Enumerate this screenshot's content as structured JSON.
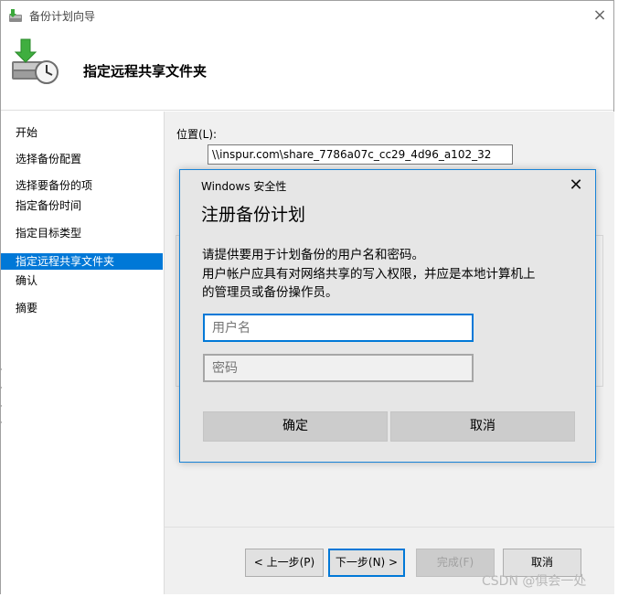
{
  "window": {
    "title": "备份计划向导",
    "close_glyph": "×",
    "header_title": "指定远程共享文件夹"
  },
  "nav": {
    "items": [
      {
        "label": "开始",
        "selected": false
      },
      {
        "label": "选择备份配置",
        "selected": false
      },
      {
        "label": "选择要备份的项",
        "selected": false
      },
      {
        "label": "指定备份时间",
        "selected": false
      },
      {
        "label": "指定目标类型",
        "selected": false
      },
      {
        "label": "指定远程共享文件夹",
        "selected": true
      },
      {
        "label": "确认",
        "selected": false
      },
      {
        "label": "摘要",
        "selected": false
      }
    ]
  },
  "content": {
    "location_label": "位置(L):",
    "location_value": "\\\\inspur.com\\share_7786a07c_cc29_4d96_a102_32"
  },
  "buttons": {
    "prev": "< 上一步(P)",
    "next": "下一步(N) >",
    "finish": "完成(F)",
    "cancel": "取消"
  },
  "security_dialog": {
    "caption": "Windows 安全性",
    "close_glyph": "✕",
    "heading": "注册备份计划",
    "message_lines": [
      "请提供要用于计划备份的用户名和密码。",
      "用户帐户应具有对网络共享的写入权限，并应是本地计算机上",
      "的管理员或备份操作员。"
    ],
    "username_placeholder": "用户名",
    "password_placeholder": "密码",
    "ok_label": "确定",
    "cancel_label": "取消"
  },
  "watermark": "CSDN @俱会一处",
  "colors": {
    "accent": "#0078d7",
    "dialog_bg": "#e6e6e6",
    "panel_bg": "#f0f0f0"
  },
  "icons": {
    "title": "backup-wizard-icon",
    "header": "backup-clock-icon"
  }
}
